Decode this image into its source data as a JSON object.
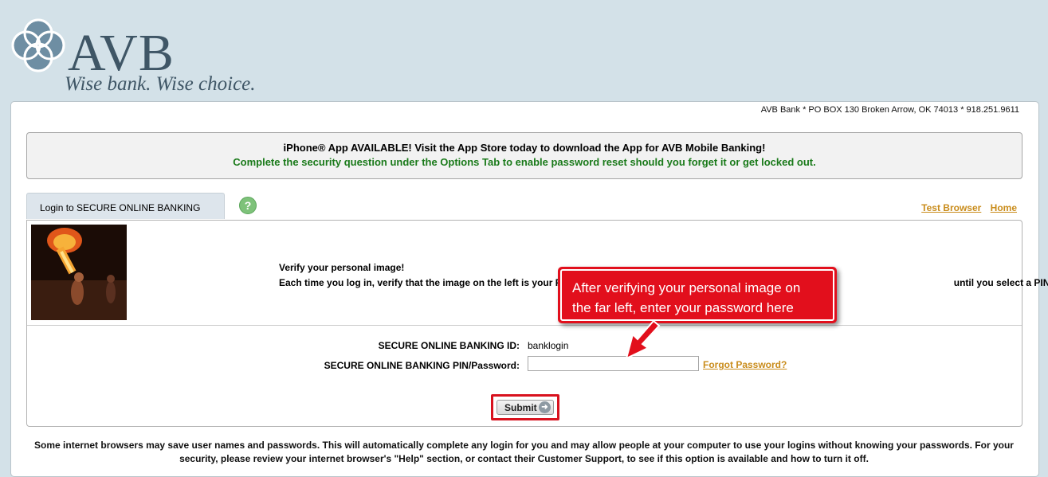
{
  "brand": {
    "name": "AVB",
    "tagline": "Wise bank. Wise choice.",
    "logo_icon": "quatrefoil-logo-icon"
  },
  "address": "AVB Bank * PO BOX 130 Broken Arrow, OK 74013 * 918.251.9611",
  "notice": {
    "line1": "iPhone® App AVAILABLE! Visit the App Store today to download the App for AVB Mobile Banking!",
    "line2": "Complete the security question under the Options Tab to enable password reset should you forget it or get locked out.",
    "line2_color": "#1a7a1a"
  },
  "tab": {
    "label": "Login to SECURE ONLINE BANKING"
  },
  "help": {
    "icon": "help-icon",
    "glyph": "?"
  },
  "links": {
    "test_browser": "Test Browser",
    "home": "Home",
    "color": "#c98c1b"
  },
  "verify": {
    "heading": "Verify your personal image!",
    "text_before": "Each time you log in, verify that the image on the left is your P",
    "text_after": "until you select a PIN."
  },
  "form": {
    "id_label": "SECURE ONLINE BANKING ID:",
    "id_value": "banklogin",
    "pin_label": "SECURE ONLINE BANKING PIN/Password:",
    "pin_value": "",
    "forgot": "Forgot Password?",
    "submit": "Submit"
  },
  "callout": {
    "line1": "After verifying  your personal image on",
    "line2": "the far left, enter your password here",
    "color": "#e20f1c"
  },
  "disclaimer": "Some internet browsers may save user names and passwords. This will automatically complete any login for you and may allow people at your computer to use your logins without knowing your passwords. For your security, please review your internet browser's \"Help\" section, or contact their Customer Support, to see if this option is available and how to turn it off."
}
